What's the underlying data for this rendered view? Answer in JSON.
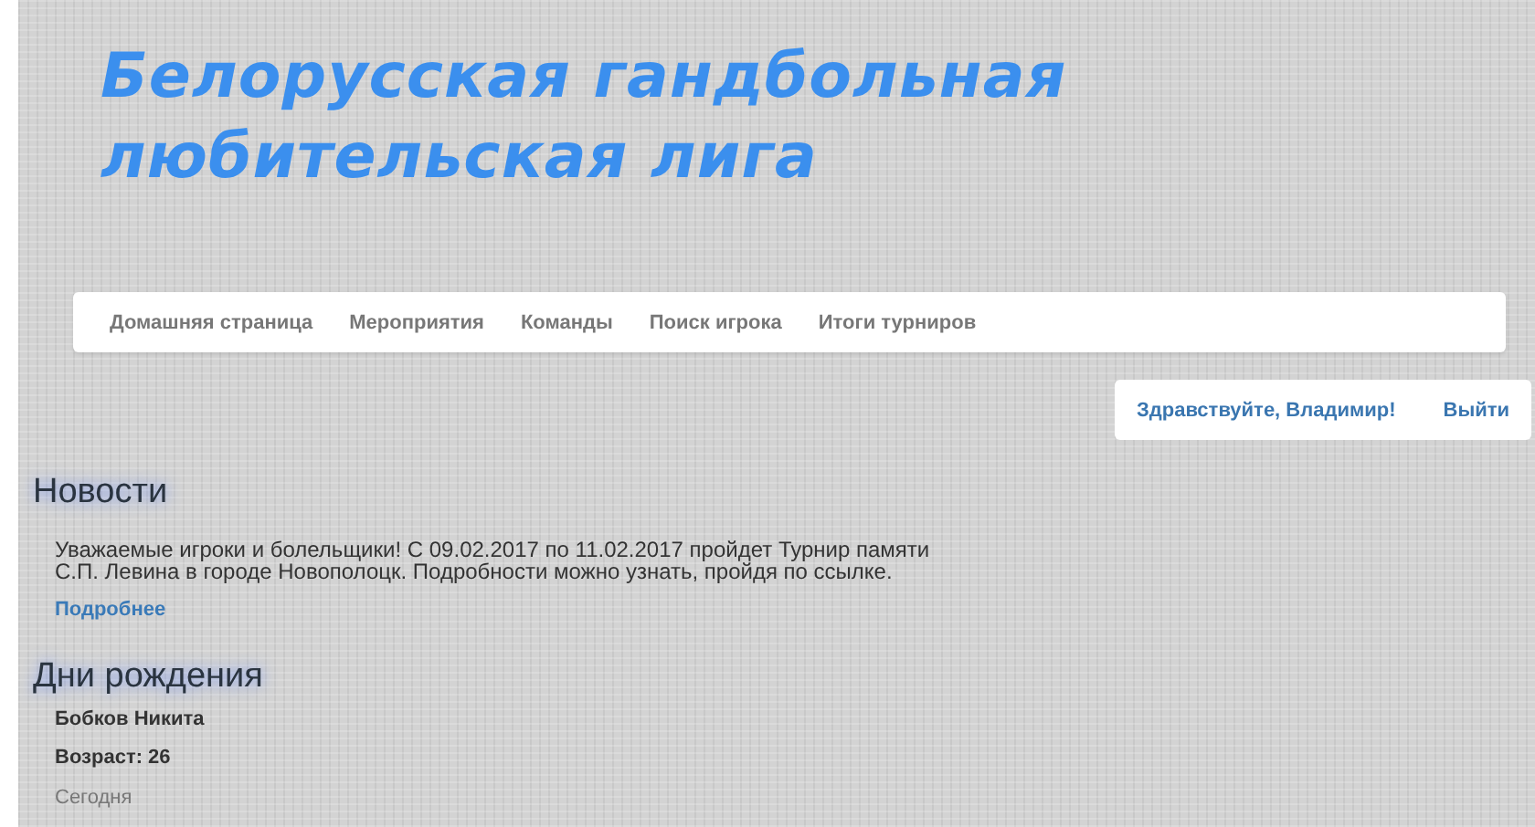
{
  "header": {
    "title_lines": [
      "Белорусская гандбольная",
      "любительская лига"
    ]
  },
  "nav": {
    "items": [
      {
        "label": "Домашняя страница"
      },
      {
        "label": "Мероприятия"
      },
      {
        "label": "Команды"
      },
      {
        "label": "Поиск игрока"
      },
      {
        "label": "Итоги турниров"
      }
    ]
  },
  "user_bar": {
    "greeting": "Здравствуйте, Владимир!",
    "logout": "Выйти"
  },
  "news": {
    "heading": "Новости",
    "text": "Уважаемые игроки и болельщики! С 09.02.2017 по 11.02.2017 пройдет Турнир памяти С.П. Левина в городе Новополоцк. Подробности можно узнать, пройдя по ссылке.",
    "more_link": "Подробнее"
  },
  "birthdays": {
    "heading": "Дни рождения",
    "entries": [
      {
        "name": "Бобков Никита",
        "age": "Возраст: 26",
        "when": "Сегодня"
      }
    ]
  }
}
